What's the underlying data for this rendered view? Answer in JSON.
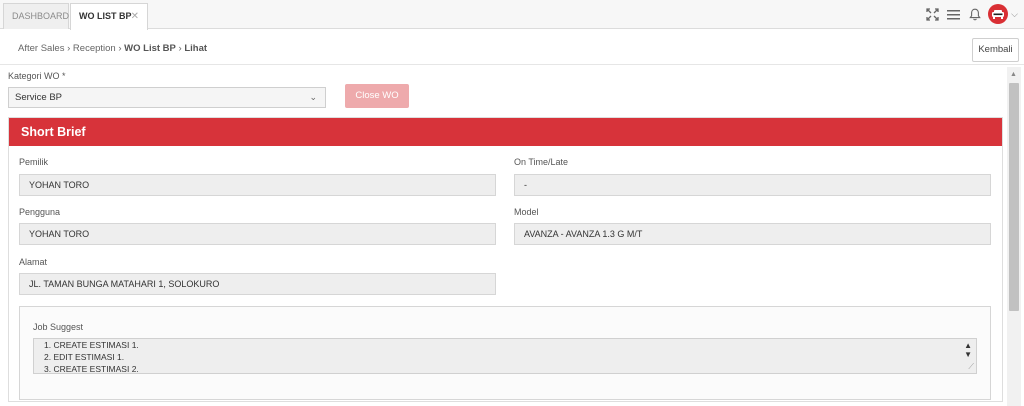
{
  "tabs": [
    {
      "label": "DASHBOARD"
    },
    {
      "label": "WO LIST BP",
      "close": "✕"
    }
  ],
  "icons": {
    "fullscreen": "fullscreen-icon",
    "menu": "hamburger-menu-icon",
    "bell": "bell-icon",
    "avatar": "car-avatar-icon"
  },
  "breadcrumb": {
    "items": [
      "After Sales",
      "Reception",
      "WO List BP",
      "Lihat"
    ],
    "separator": "›"
  },
  "back_label": "Kembali",
  "kategori": {
    "label": "Kategori WO *",
    "value": "Service BP"
  },
  "close_wo_label": "Close WO",
  "panel": {
    "title": "Short Brief",
    "fields": {
      "pemilik": {
        "label": "Pemilik",
        "value": "YOHAN TORO"
      },
      "ontime": {
        "label": "On Time/Late",
        "value": "-"
      },
      "pengguna": {
        "label": "Pengguna",
        "value": "YOHAN TORO"
      },
      "model": {
        "label": "Model",
        "value": "AVANZA - AVANZA 1.3 G M/T"
      },
      "alamat": {
        "label": "Alamat",
        "value": "JL. TAMAN BUNGA MATAHARI 1, SOLOKURO"
      }
    },
    "job_suggest": {
      "label": "Job Suggest",
      "lines": [
        "1. CREATE ESTIMASI 1.",
        "2. EDIT ESTIMASI 1.",
        "3. CREATE ESTIMASI 2."
      ]
    }
  },
  "colors": {
    "accent": "#d7333a",
    "close_wo_bg": "#eeaaac"
  }
}
